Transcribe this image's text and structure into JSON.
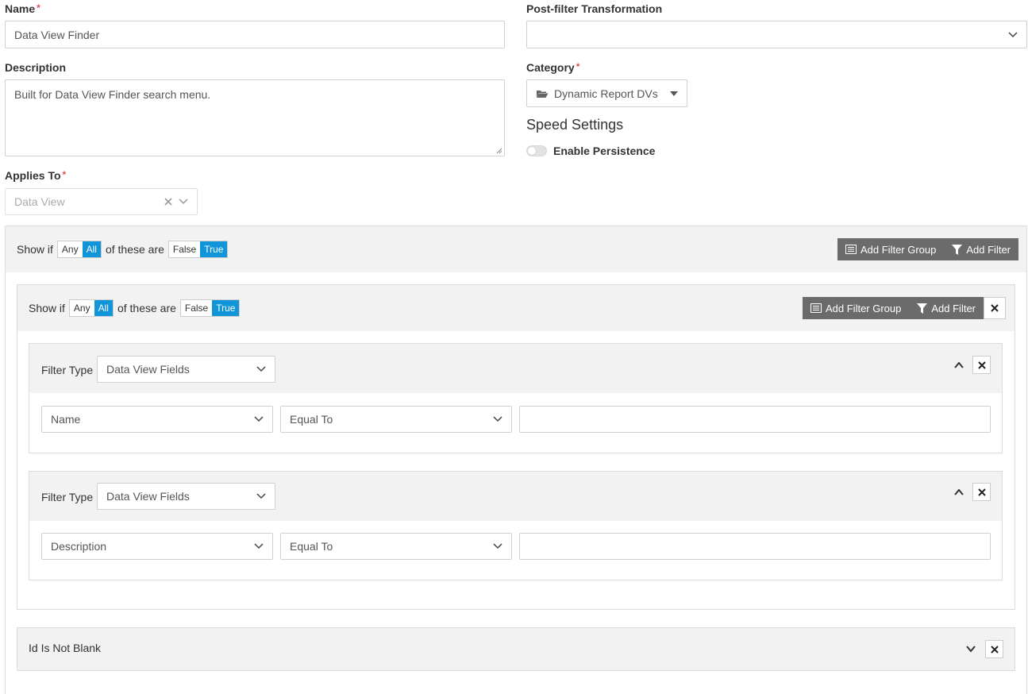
{
  "form": {
    "name_label": "Name",
    "name_value": "Data View Finder",
    "description_label": "Description",
    "description_value": "Built for Data View Finder search menu.",
    "applies_to_label": "Applies To",
    "applies_to_value": "Data View",
    "post_filter_label": "Post-filter Transformation",
    "post_filter_value": "",
    "category_label": "Category",
    "category_value": "Dynamic Report DVs",
    "speed_heading": "Speed Settings",
    "persistence_label": "Enable Persistence",
    "required_mark": "*"
  },
  "outer_group": {
    "show_if": "Show if",
    "any": "Any",
    "all": "All",
    "of_these_are": "of these are",
    "false": "False",
    "true": "True",
    "add_filter_group": "Add Filter Group",
    "add_filter": "Add Filter"
  },
  "inner_group": {
    "show_if": "Show if",
    "any": "Any",
    "all": "All",
    "of_these_are": "of these are",
    "false": "False",
    "true": "True",
    "add_filter_group": "Add Filter Group",
    "add_filter": "Add Filter"
  },
  "filters": [
    {
      "filter_type_label": "Filter Type",
      "filter_type_value": "Data View Fields",
      "field": "Name",
      "operator": "Equal To",
      "value": ""
    },
    {
      "filter_type_label": "Filter Type",
      "filter_type_value": "Data View Fields",
      "field": "Description",
      "operator": "Equal To",
      "value": ""
    }
  ],
  "collapsed_filter": {
    "label": "Id Is Not Blank"
  },
  "colors": {
    "accent": "#0f95d8",
    "button_dark": "#6b6b6b",
    "panel_bg": "#f2f2f2",
    "required": "#d9534f"
  }
}
